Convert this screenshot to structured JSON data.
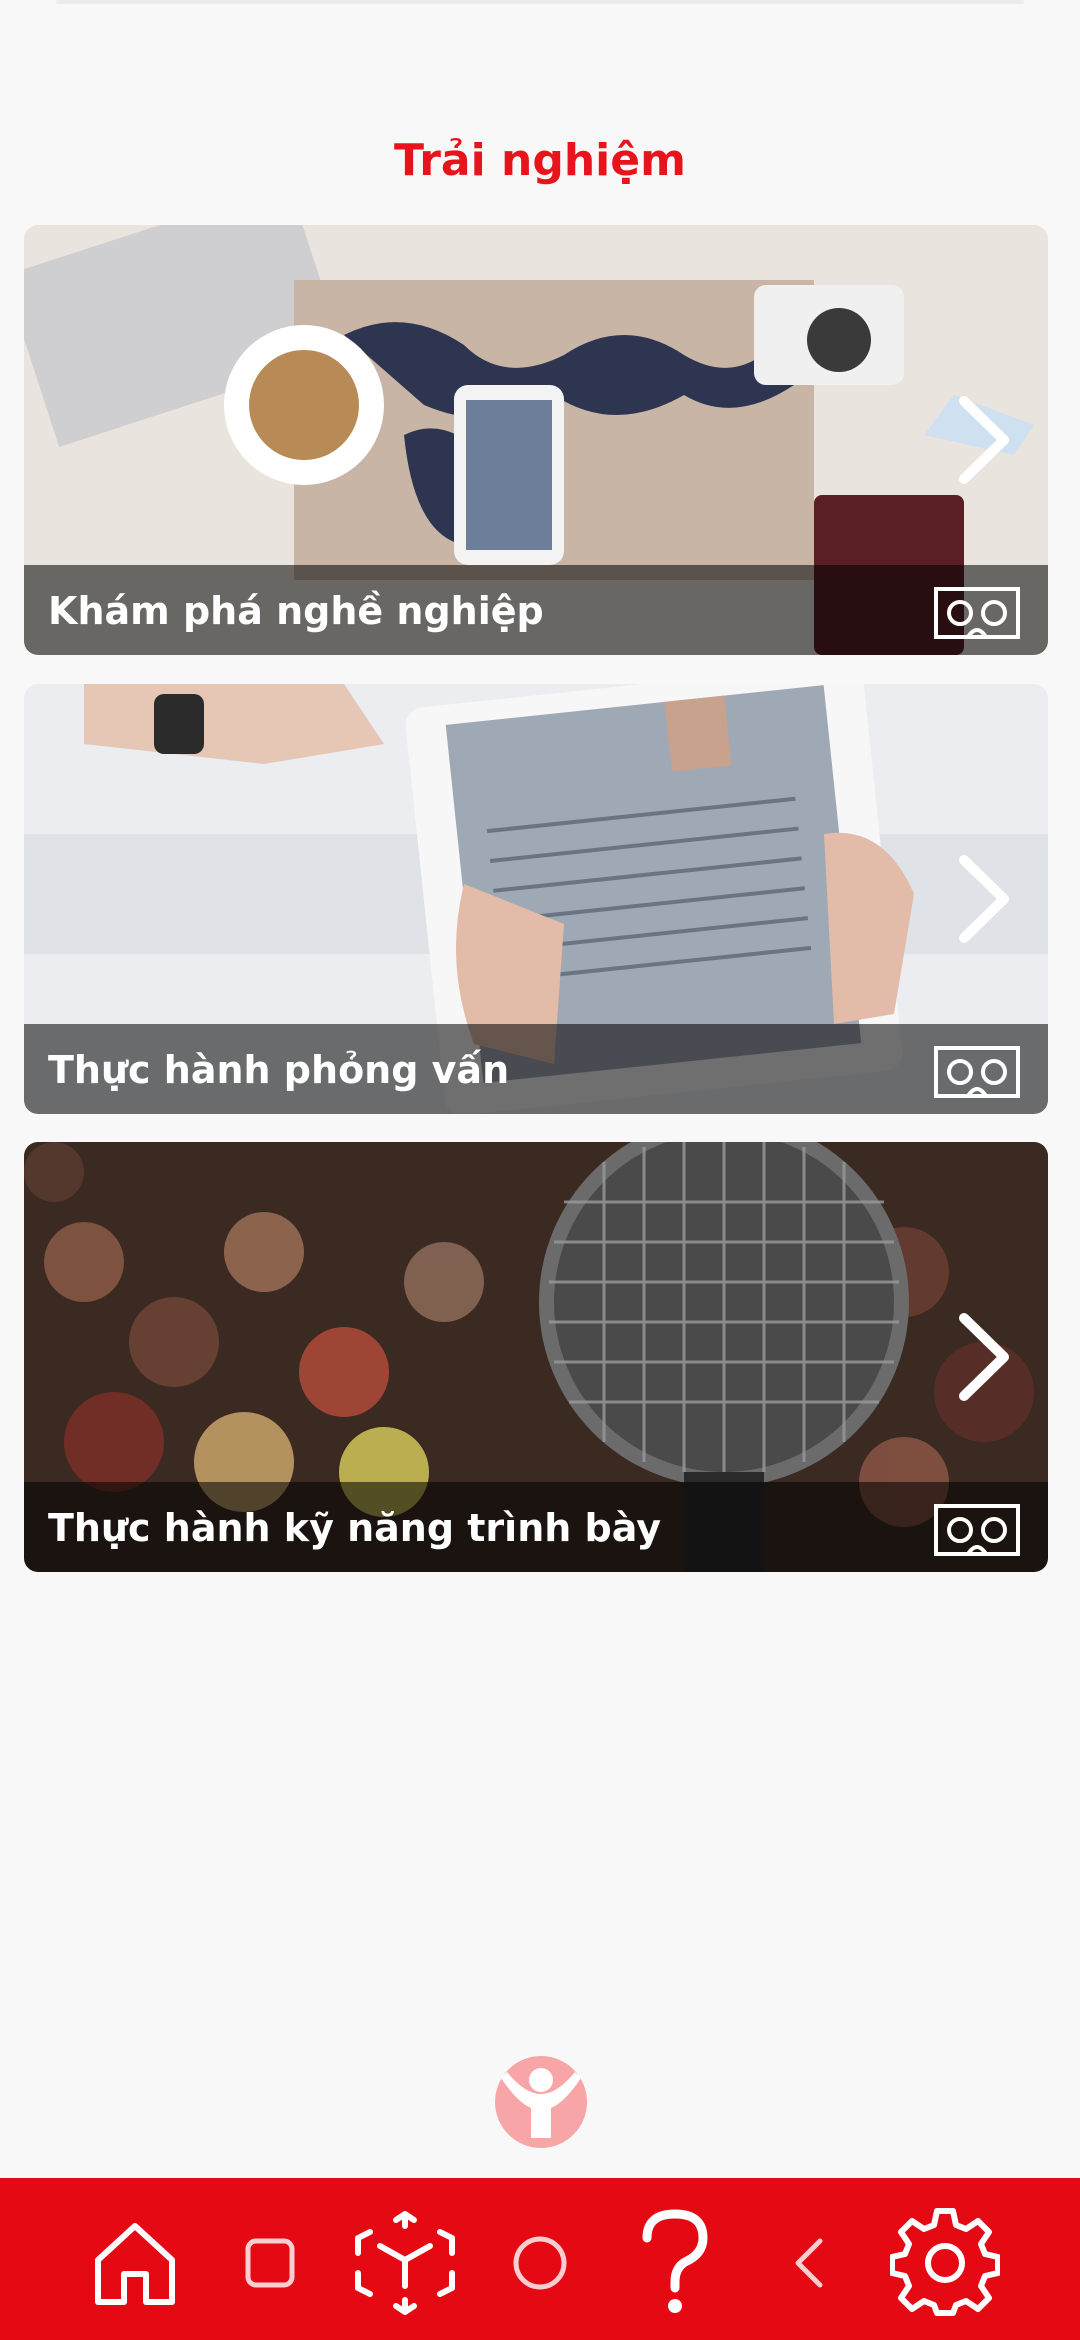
{
  "section": {
    "title": "Trải nghiệm"
  },
  "cards": [
    {
      "label": "Khám phá nghề nghiệp",
      "icon": "vr-headset-icon",
      "action_icon": "chevron-right-icon"
    },
    {
      "label": "Thực hành phỏng vấn",
      "icon": "vr-headset-icon",
      "action_icon": "chevron-right-icon"
    },
    {
      "label": "Thực hành kỹ năng trình bày",
      "icon": "vr-headset-icon",
      "action_icon": "chevron-right-icon"
    }
  ],
  "footer": {
    "logo": "child-logo-icon"
  },
  "navbar": {
    "items": [
      "home-icon",
      "recent-apps-icon",
      "ar-cube-icon",
      "system-home-icon",
      "help-icon",
      "back-icon",
      "settings-icon"
    ]
  },
  "colors": {
    "accent": "#e50914",
    "title": "#e8141b",
    "background": "#f8f8f8"
  }
}
